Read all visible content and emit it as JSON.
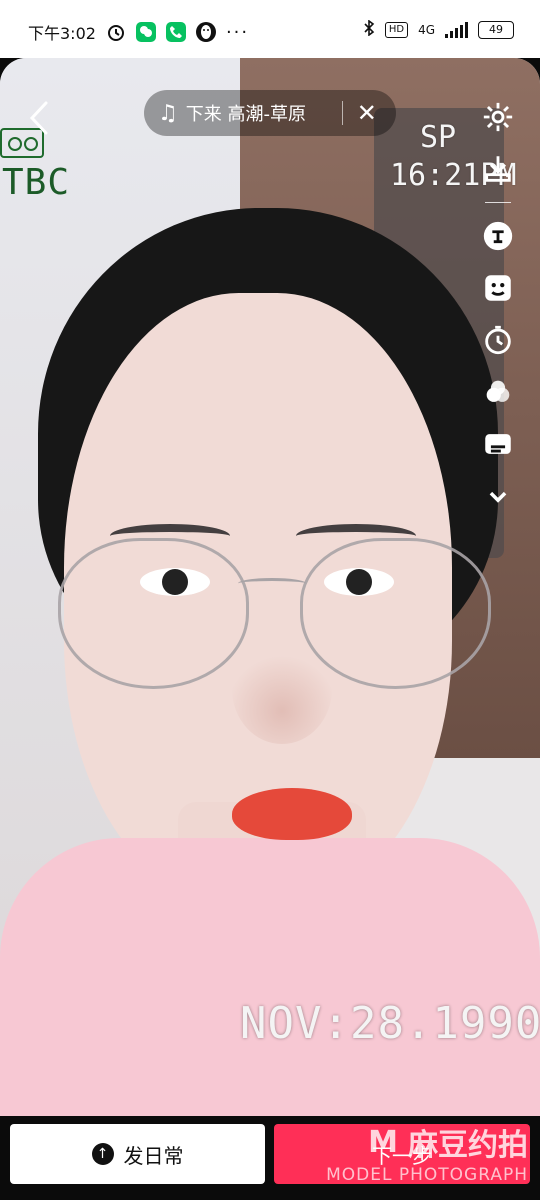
{
  "status_bar": {
    "time": "下午3:02",
    "network": "4G",
    "hd": "HD",
    "battery": "49",
    "more": "···"
  },
  "music": {
    "title": "下来 高潮-草原",
    "icon": "music-note-icon",
    "close": "✕"
  },
  "overlay": {
    "tbc": "TBC",
    "sp": "SP",
    "time": "16:21PM",
    "date": "NOV:28.1990"
  },
  "tools": [
    "gear-icon",
    "download-icon",
    "text-icon",
    "sticker-icon",
    "timer-icon",
    "filters-icon",
    "captions-icon",
    "chevron-down-icon"
  ],
  "bottom": {
    "daily_label": "发日常",
    "next_label": "下一步"
  },
  "watermark": {
    "main": "麻豆约拍",
    "sub": "MODEL PHOTOGRAPH"
  },
  "colors": {
    "accent": "#ff2f57",
    "overlay_text": "#f5f5f5",
    "overlay_green": "#1c5b28"
  }
}
